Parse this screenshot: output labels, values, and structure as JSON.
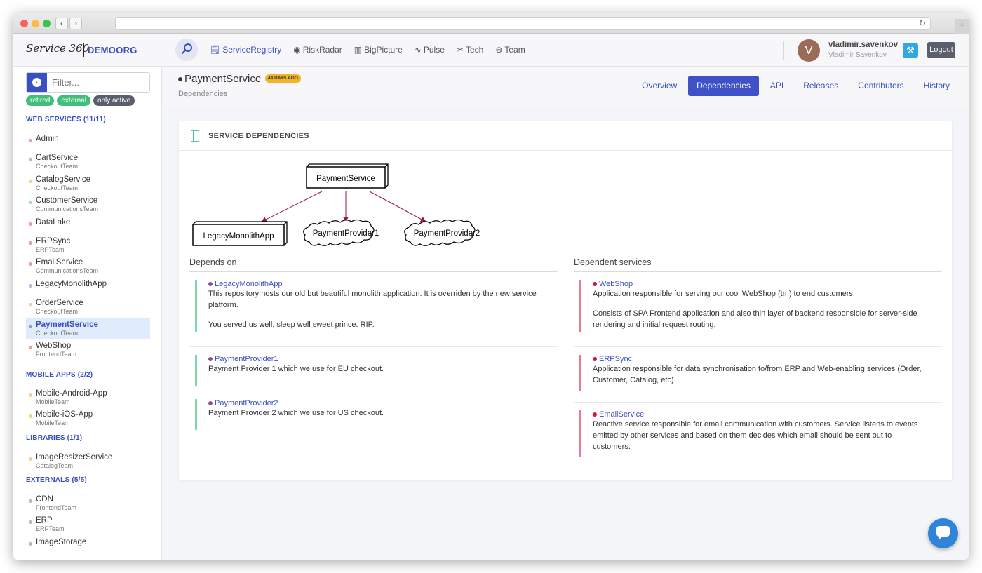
{
  "header": {
    "logo_text": "Service 360",
    "org": "DEMOORG",
    "nav": [
      {
        "label": "ServiceRegistry",
        "icon": "clipboard-icon"
      },
      {
        "label": "RiskRadar",
        "icon": "eye-icon"
      },
      {
        "label": "BigPicture",
        "icon": "map-icon"
      },
      {
        "label": "Pulse",
        "icon": "pulse-icon"
      },
      {
        "label": "Tech",
        "icon": "tools-icon"
      },
      {
        "label": "Team",
        "icon": "team-icon"
      }
    ],
    "user": {
      "initial": "V",
      "username": "vladimir.savenkov",
      "fullname": "Vladimir Savenkov"
    },
    "logout_label": "Logout"
  },
  "sidebar": {
    "filter_placeholder": "Filter...",
    "chips": [
      "retired",
      "external",
      "only active"
    ],
    "sections": {
      "web": "WEB SERVICES (11/11)",
      "mobile": "MOBILE APPS (2/2)",
      "libs": "LIBRARIES (1/1)",
      "ext": "EXTERNALS (5/5)"
    },
    "web_services": [
      {
        "name": "Admin",
        "team": "",
        "color": "#e99bb0"
      },
      {
        "name": "CartService",
        "team": "CheckoutTeam",
        "color": "#b8b8c2"
      },
      {
        "name": "CatalogService",
        "team": "CheckoutTeam",
        "color": "#f3d08e"
      },
      {
        "name": "CustomerService",
        "team": "CommunicationsTeam",
        "color": "#9ee0c0"
      },
      {
        "name": "DataLake",
        "team": "",
        "color": "#e99bb0"
      },
      {
        "name": "ERPSync",
        "team": "ERPTeam",
        "color": "#e99bb0"
      },
      {
        "name": "EmailService",
        "team": "CommunicationsTeam",
        "color": "#e99bb0"
      },
      {
        "name": "LegacyMonolithApp",
        "team": "",
        "color": "#c9b3dc"
      },
      {
        "name": "OrderService",
        "team": "CheckoutTeam",
        "color": "#f3d08e"
      },
      {
        "name": "PaymentService",
        "team": "CheckoutTeam",
        "color": "#8ea4c8"
      },
      {
        "name": "WebShop",
        "team": "FrontendTeam",
        "color": "#e99bb0"
      }
    ],
    "mobile_apps": [
      {
        "name": "Mobile-Android-App",
        "team": "MobileTeam",
        "color": "#f3d08e"
      },
      {
        "name": "Mobile-iOS-App",
        "team": "MobileTeam",
        "color": "#f3d08e"
      }
    ],
    "libraries": [
      {
        "name": "ImageResizerService",
        "team": "CatalogTeam",
        "color": "#f3d08e"
      }
    ],
    "externals": [
      {
        "name": "CDN",
        "team": "FrontendTeam",
        "color": "#b8b8c2"
      },
      {
        "name": "ERP",
        "team": "ERPTeam",
        "color": "#b8b8c2"
      },
      {
        "name": "ImageStorage",
        "team": "",
        "color": "#b8b8c2"
      }
    ]
  },
  "page": {
    "title": "PaymentService",
    "age_badge": "44 DAYS AGO",
    "subtitle": "Dependencies",
    "tabs": [
      "Overview",
      "Dependencies",
      "API",
      "Releases",
      "Contributors",
      "History"
    ],
    "active_tab": "Dependencies"
  },
  "card": {
    "title": "SERVICE DEPENDENCIES",
    "diagram": {
      "root": "PaymentService",
      "children": [
        "LegacyMonolithApp",
        "PaymentProvider1",
        "PaymentProvider2"
      ],
      "arrow_color": "#a0154a"
    },
    "depends_on_title": "Depends on",
    "dependents_title": "Dependent services",
    "depends_on": [
      {
        "name": "LegacyMonolithApp",
        "desc": [
          "This repository hosts our old but beautiful monolith application. It is overriden by the new service platform.",
          "You served us well, sleep well sweet prince. RIP."
        ]
      },
      {
        "name": "PaymentProvider1",
        "desc": [
          "Payment Provider 1 which we use for EU checkout."
        ]
      },
      {
        "name": "PaymentProvider2",
        "desc": [
          "Payment Provider 2 which we use for US checkout."
        ]
      }
    ],
    "dependents": [
      {
        "name": "WebShop",
        "desc": [
          "Application responsible for serving our cool WebShop (tm) to end customers.",
          "Consists of SPA Frontend application and also thin layer of backend responsible for server-side rendering and initial request routing."
        ]
      },
      {
        "name": "ERPSync",
        "desc": [
          "Application responsible for data synchronisation to/from ERP and Web-enabling services (Order, Customer, Catalog, etc)."
        ]
      },
      {
        "name": "EmailService",
        "desc": [
          "Reactive service responsible for email communication with customers. Service listens to events emitted by other services and based on them decides which email should be sent out to customers."
        ]
      }
    ]
  },
  "colors": {
    "accent": "#3f51c6",
    "depends_dot": "#8b4d9a",
    "dependent_dot": "#d8163d"
  }
}
